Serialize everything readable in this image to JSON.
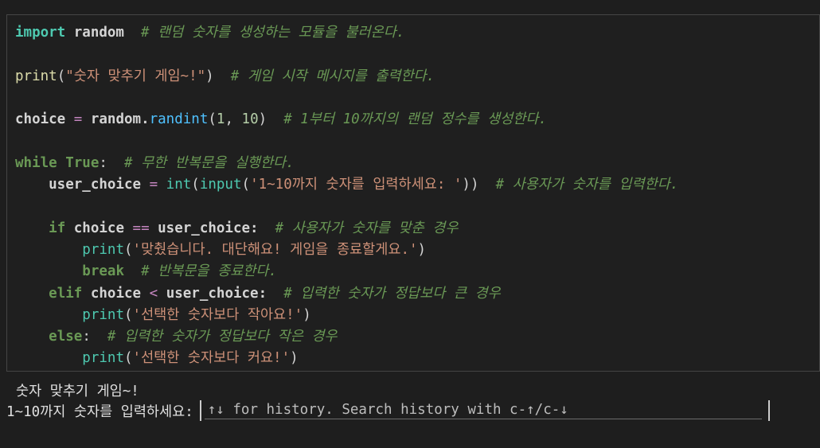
{
  "code_cell": {
    "lines": [
      [
        {
          "text": "import",
          "cls": "kw b"
        },
        {
          "text": " random  ",
          "cls": "txt b"
        },
        {
          "text": "# 랜덤 숫자를 생성하는 모듈을 불러온다.",
          "cls": "cmt"
        }
      ],
      [],
      [
        {
          "text": "print",
          "cls": "fn"
        },
        {
          "text": "(",
          "cls": "txt"
        },
        {
          "text": "\"숫자 맞추기 게임~!\"",
          "cls": "str"
        },
        {
          "text": ")  ",
          "cls": "txt"
        },
        {
          "text": "# 게임 시작 메시지를 출력한다.",
          "cls": "cmt"
        }
      ],
      [],
      [
        {
          "text": "choice ",
          "cls": "txt b"
        },
        {
          "text": "=",
          "cls": "op"
        },
        {
          "text": " random.",
          "cls": "txt b"
        },
        {
          "text": "randint",
          "cls": "fnb"
        },
        {
          "text": "(",
          "cls": "txt"
        },
        {
          "text": "1",
          "cls": "num"
        },
        {
          "text": ", ",
          "cls": "txt"
        },
        {
          "text": "10",
          "cls": "num"
        },
        {
          "text": ")  ",
          "cls": "txt"
        },
        {
          "text": "# 1부터 10까지의 랜덤 정수를 생성한다.",
          "cls": "cmt"
        }
      ],
      [],
      [
        {
          "text": "while",
          "cls": "kwb"
        },
        {
          "text": " ",
          "cls": "txt"
        },
        {
          "text": "True",
          "cls": "kwb"
        },
        {
          "text": ":  ",
          "cls": "txt"
        },
        {
          "text": "# 무한 반복문을 실행한다.",
          "cls": "cmt"
        }
      ],
      [
        {
          "text": "    user_choice ",
          "cls": "txt b"
        },
        {
          "text": "=",
          "cls": "op"
        },
        {
          "text": " ",
          "cls": "txt"
        },
        {
          "text": "int",
          "cls": "bi"
        },
        {
          "text": "(",
          "cls": "txt"
        },
        {
          "text": "input",
          "cls": "bi"
        },
        {
          "text": "(",
          "cls": "txt"
        },
        {
          "text": "'1~10까지 숫자를 입력하세요: '",
          "cls": "str"
        },
        {
          "text": "))  ",
          "cls": "txt"
        },
        {
          "text": "# 사용자가 숫자를 입력한다.",
          "cls": "cmt"
        }
      ],
      [],
      [
        {
          "text": "    ",
          "cls": "txt"
        },
        {
          "text": "if",
          "cls": "kwb"
        },
        {
          "text": " choice ",
          "cls": "txt b"
        },
        {
          "text": "==",
          "cls": "op"
        },
        {
          "text": " user_choice:  ",
          "cls": "txt b"
        },
        {
          "text": "# 사용자가 숫자를 맞춘 경우",
          "cls": "cmt"
        }
      ],
      [
        {
          "text": "        ",
          "cls": "txt"
        },
        {
          "text": "print",
          "cls": "bi"
        },
        {
          "text": "(",
          "cls": "txt"
        },
        {
          "text": "'맞췄습니다. 대단해요! 게임을 종료할게요.'",
          "cls": "str"
        },
        {
          "text": ")",
          "cls": "txt"
        }
      ],
      [
        {
          "text": "        ",
          "cls": "txt"
        },
        {
          "text": "break",
          "cls": "kwb"
        },
        {
          "text": "  ",
          "cls": "txt"
        },
        {
          "text": "# 반복문을 종료한다.",
          "cls": "cmt"
        }
      ],
      [
        {
          "text": "    ",
          "cls": "txt"
        },
        {
          "text": "elif",
          "cls": "kwb"
        },
        {
          "text": " choice ",
          "cls": "txt b"
        },
        {
          "text": "<",
          "cls": "op"
        },
        {
          "text": " user_choice:  ",
          "cls": "txt b"
        },
        {
          "text": "# 입력한 숫자가 정답보다 큰 경우",
          "cls": "cmt"
        }
      ],
      [
        {
          "text": "        ",
          "cls": "txt"
        },
        {
          "text": "print",
          "cls": "bi"
        },
        {
          "text": "(",
          "cls": "txt"
        },
        {
          "text": "'선택한 숫자보다 작아요!'",
          "cls": "str"
        },
        {
          "text": ")",
          "cls": "txt"
        }
      ],
      [
        {
          "text": "    ",
          "cls": "txt"
        },
        {
          "text": "else",
          "cls": "kwb"
        },
        {
          "text": ":  ",
          "cls": "txt"
        },
        {
          "text": "# 입력한 숫자가 정답보다 작은 경우",
          "cls": "cmt"
        }
      ],
      [
        {
          "text": "        ",
          "cls": "txt"
        },
        {
          "text": "print",
          "cls": "bi"
        },
        {
          "text": "(",
          "cls": "txt"
        },
        {
          "text": "'선택한 숫자보다 커요!'",
          "cls": "str"
        },
        {
          "text": ")",
          "cls": "txt"
        }
      ]
    ]
  },
  "output": {
    "first_line": "숫자 맞추기 게임~!",
    "prompt_label": "1~10까지 숫자를 입력하세요:",
    "input_value": "",
    "input_placeholder": "↑↓ for history. Search history with c-↑/c-↓"
  }
}
